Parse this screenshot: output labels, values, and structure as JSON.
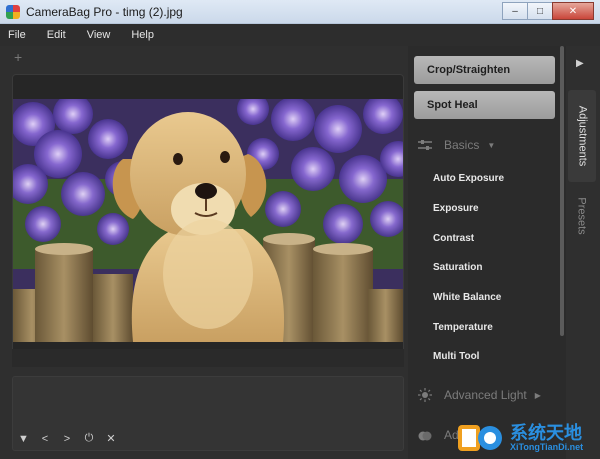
{
  "window": {
    "title": "CameraBag Pro - timg (2).jpg",
    "controls": {
      "minimize": "–",
      "maximize": "□",
      "close": "✕"
    }
  },
  "menu": [
    "File",
    "Edit",
    "View",
    "Help"
  ],
  "canvas": {
    "add_tab": "+"
  },
  "tools": {
    "crop_straighten": "Crop/Straighten",
    "spot_heal": "Spot Heal"
  },
  "sections": {
    "basics": {
      "label": "Basics",
      "icon": "sliders-icon",
      "arrow": "▼"
    },
    "advanced_light": {
      "label": "Advanced Light",
      "icon": "sun-icon",
      "arrow": "▶"
    },
    "advanced_color": {
      "label": "Ad",
      "icon": "color-drop-icon"
    }
  },
  "adjustments": [
    "Auto Exposure",
    "Exposure",
    "Contrast",
    "Saturation",
    "White Balance",
    "Temperature",
    "Multi Tool"
  ],
  "side_tabs": {
    "adjustments": "Adjustments",
    "presets": "Presets",
    "arrow": "▶"
  },
  "filmstrip_controls": [
    "▼",
    "<",
    ">",
    "⏻",
    "✕"
  ],
  "watermark": {
    "cn": "系统天地",
    "en": "XiTongTianDi.net"
  },
  "colors": {
    "accent_blue": "#2a8fe0",
    "panel": "#2b2b2b",
    "button": "#b0b0b0"
  }
}
